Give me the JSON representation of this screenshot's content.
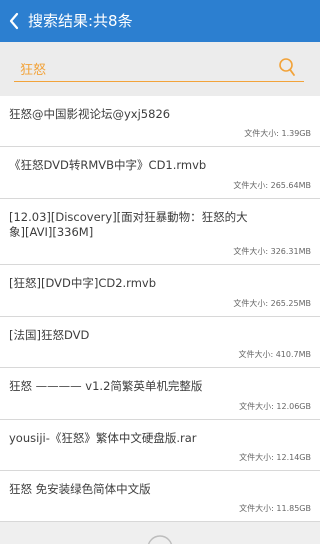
{
  "header": {
    "title": "搜索结果:共8条",
    "back_icon": "chevron-left-icon",
    "background": "#2c7fd0"
  },
  "search": {
    "value": "狂怒",
    "icon": "search-icon",
    "accent": "#f2a33a"
  },
  "results": [
    {
      "name": "狂怒@中国影视论坛@yxj5826",
      "size": "文件大小: 1.39GB"
    },
    {
      "name": "《狂怒DVD转RMVB中字》CD1.rmvb",
      "size": "文件大小: 265.64MB"
    },
    {
      "name": "[12.03][Discovery][面对狂暴動物：狂怒的大象][AVI][336M]",
      "size": "文件大小: 326.31MB"
    },
    {
      "name": "[狂怒][DVD中字]CD2.rmvb",
      "size": "文件大小: 265.25MB"
    },
    {
      "name": "[法国]狂怒DVD",
      "size": "文件大小: 410.7MB"
    },
    {
      "name": "狂怒 ———— v1.2简繁英单机完整版",
      "size": "文件大小: 12.06GB"
    },
    {
      "name": "yousiji-《狂怒》繁体中文硬盘版.rar",
      "size": "文件大小: 12.14GB"
    },
    {
      "name": "狂怒 免安装绿色简体中文版",
      "size": "文件大小: 11.85GB"
    }
  ],
  "footer": {
    "indicator": "loading-icon"
  }
}
